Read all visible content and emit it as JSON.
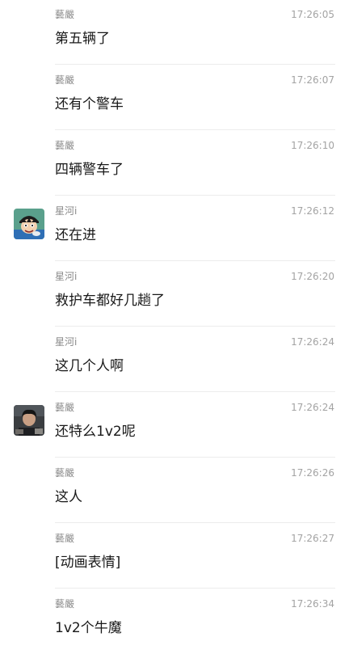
{
  "messages": [
    {
      "sender": "藝嚴",
      "time": "17:26:05",
      "text": "第五辆了",
      "avatar": null
    },
    {
      "sender": "藝嚴",
      "time": "17:26:07",
      "text": "还有个警车",
      "avatar": null
    },
    {
      "sender": "藝嚴",
      "time": "17:26:10",
      "text": "四辆警车了",
      "avatar": null
    },
    {
      "sender": "星河i",
      "time": "17:26:12",
      "text": "还在进",
      "avatar": "cartoon-boy-avatar"
    },
    {
      "sender": "星河i",
      "time": "17:26:20",
      "text": "救护车都好几趟了",
      "avatar": null
    },
    {
      "sender": "星河i",
      "time": "17:26:24",
      "text": "这几个人啊",
      "avatar": null
    },
    {
      "sender": "藝嚴",
      "time": "17:26:24",
      "text": "还特么1v2呢",
      "avatar": "photo-person-avatar"
    },
    {
      "sender": "藝嚴",
      "time": "17:26:26",
      "text": "这人",
      "avatar": null
    },
    {
      "sender": "藝嚴",
      "time": "17:26:27",
      "text": "[动画表情]",
      "avatar": null
    },
    {
      "sender": "藝嚴",
      "time": "17:26:34",
      "text": "1v2个牛魔",
      "avatar": null
    }
  ]
}
